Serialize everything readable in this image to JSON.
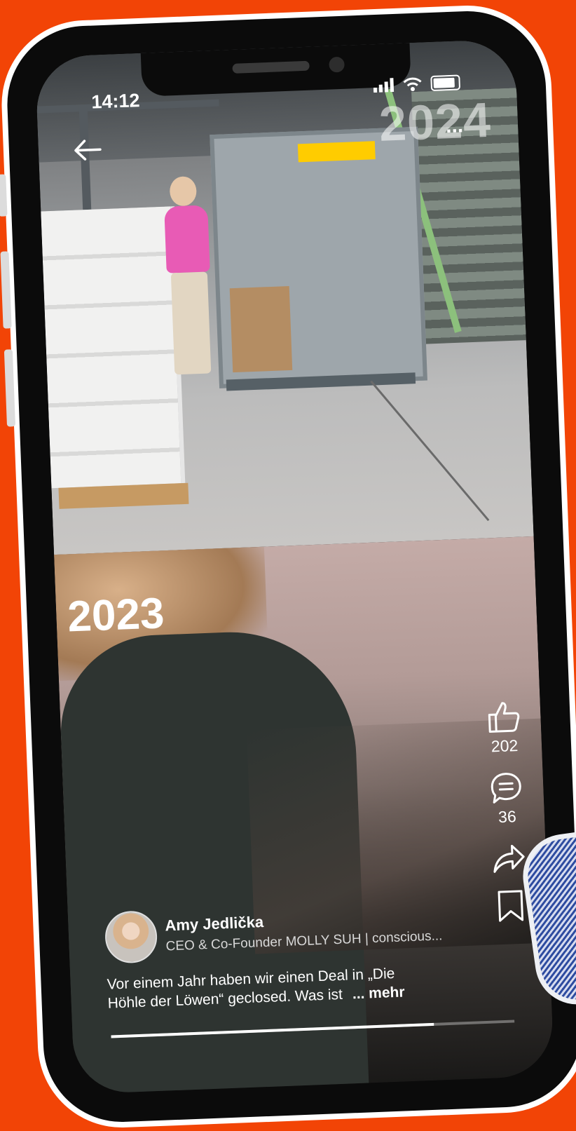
{
  "status_bar": {
    "time": "14:12"
  },
  "video": {
    "year_top": "2024",
    "year_top_overlay": "...",
    "year_bottom": "2023",
    "progress": 0.8
  },
  "actions": {
    "likes": "202",
    "comments": "36"
  },
  "author": {
    "name": "Amy Jedlička",
    "title": "CEO & Co-Founder MOLLY SUH | conscious..."
  },
  "caption": {
    "line1": "Vor einem Jahr haben wir einen Deal in „Die",
    "line2": "Höhle der Löwen“ geclosed. Was ist",
    "more": "... mehr"
  },
  "colors": {
    "background": "#f24406",
    "phone_frame": "#ffffff"
  }
}
